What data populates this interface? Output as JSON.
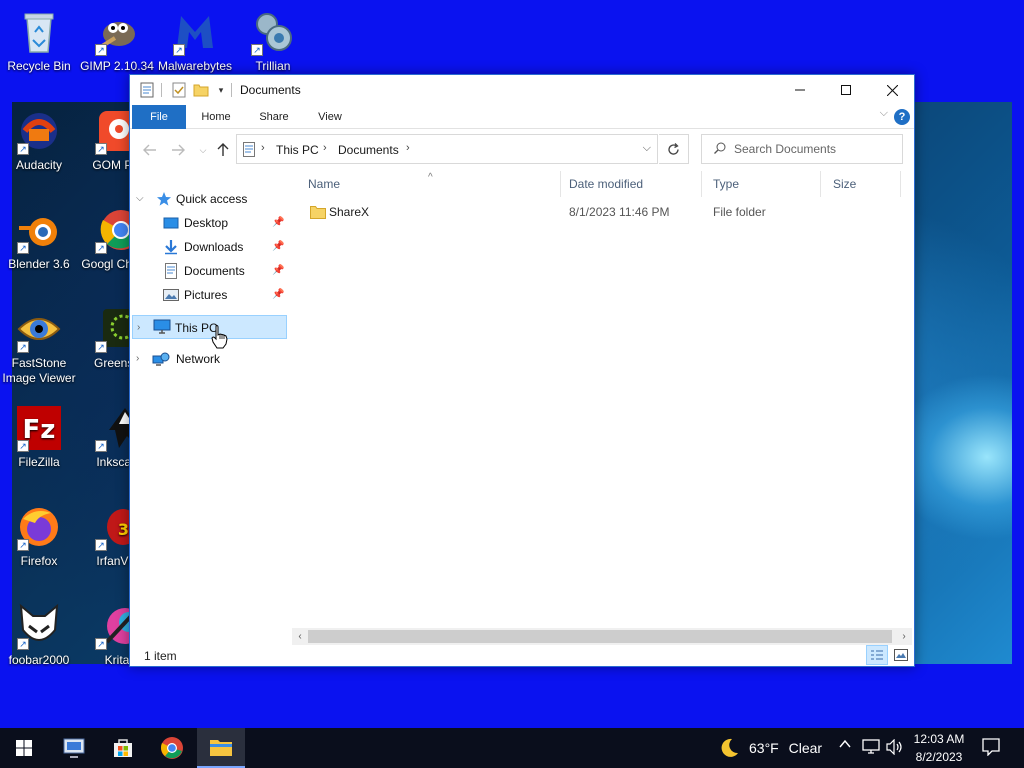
{
  "desktop": {
    "icons": [
      {
        "label": "Recycle Bin"
      },
      {
        "label": "GIMP 2.10.34"
      },
      {
        "label": "Malwarebytes"
      },
      {
        "label": "Trillian"
      },
      {
        "label": "Audacity"
      },
      {
        "label": "GOM Pla"
      },
      {
        "label": "Blender 3.6"
      },
      {
        "label": "Googl Chrom"
      },
      {
        "label": "FastStone Image Viewer"
      },
      {
        "label": "Greensh"
      },
      {
        "label": "FileZilla"
      },
      {
        "label": "Inkscap"
      },
      {
        "label": "Firefox"
      },
      {
        "label": "IrfanVie"
      },
      {
        "label": "foobar2000"
      },
      {
        "label": "Krita"
      }
    ],
    "colors": {
      "background": "#0a12f0"
    }
  },
  "window": {
    "title": "Documents",
    "tabs": {
      "file": "File",
      "home": "Home",
      "share": "Share",
      "view": "View"
    },
    "help": "?",
    "address": {
      "crumb1": "This PC",
      "crumb2": "Documents"
    },
    "search": {
      "placeholder": "Search Documents"
    },
    "nav": {
      "quick_access": "Quick access",
      "desktop": "Desktop",
      "downloads": "Downloads",
      "documents": "Documents",
      "pictures": "Pictures",
      "this_pc": "This PC",
      "network": "Network"
    },
    "columns": {
      "name": "Name",
      "date": "Date modified",
      "type": "Type",
      "size": "Size"
    },
    "files": [
      {
        "name": "ShareX",
        "date": "8/1/2023 11:46 PM",
        "type": "File folder",
        "size": ""
      }
    ],
    "status": "1 item",
    "colors": {
      "accent": "#1f6fc5",
      "selection": "#cce8ff"
    }
  },
  "taskbar": {
    "weather": {
      "temp": "63°F",
      "condition": "Clear"
    },
    "clock": {
      "time": "12:03 AM",
      "date": "8/2/2023"
    }
  }
}
